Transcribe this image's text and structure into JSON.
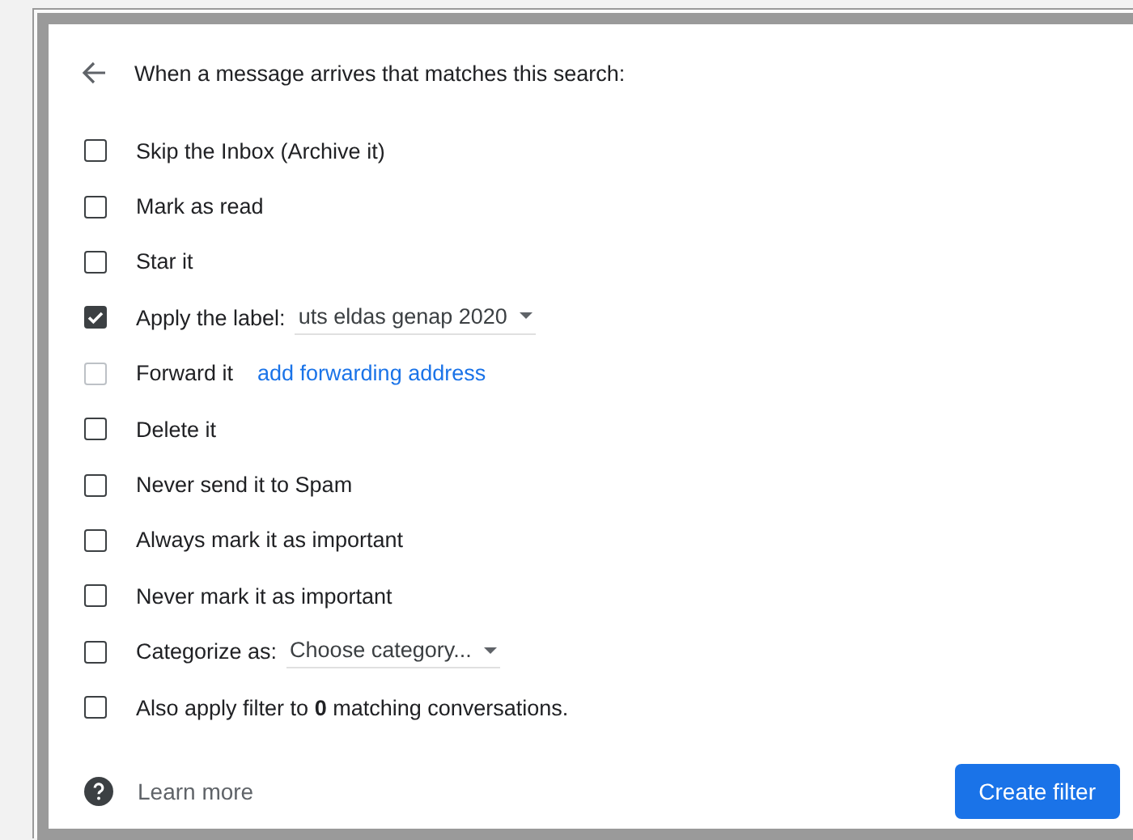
{
  "header": {
    "title": "When a message arrives that matches this search:"
  },
  "options": [
    {
      "kind": "plain",
      "label": "Skip the Inbox (Archive it)",
      "checked": false,
      "disabled": false
    },
    {
      "kind": "plain",
      "label": "Mark as read",
      "checked": false,
      "disabled": false
    },
    {
      "kind": "plain",
      "label": "Star it",
      "checked": false,
      "disabled": false
    },
    {
      "kind": "dropdown",
      "label": "Apply the label:",
      "value": "uts eldas genap 2020",
      "checked": true,
      "disabled": false
    },
    {
      "kind": "link",
      "label": "Forward it",
      "link": "add forwarding address",
      "checked": false,
      "disabled": true
    },
    {
      "kind": "plain",
      "label": "Delete it",
      "checked": false,
      "disabled": false
    },
    {
      "kind": "plain",
      "label": "Never send it to Spam",
      "checked": false,
      "disabled": false
    },
    {
      "kind": "plain",
      "label": "Always mark it as important",
      "checked": false,
      "disabled": false
    },
    {
      "kind": "plain",
      "label": "Never mark it as important",
      "checked": false,
      "disabled": false
    },
    {
      "kind": "dropdown",
      "label": "Categorize as:",
      "value": "Choose category...",
      "checked": false,
      "disabled": false
    },
    {
      "kind": "rich",
      "label": "Also apply filter to **0** matching conversations.",
      "checked": false,
      "disabled": false
    }
  ],
  "footer": {
    "help_link": "Learn more",
    "button": "Create filter"
  }
}
